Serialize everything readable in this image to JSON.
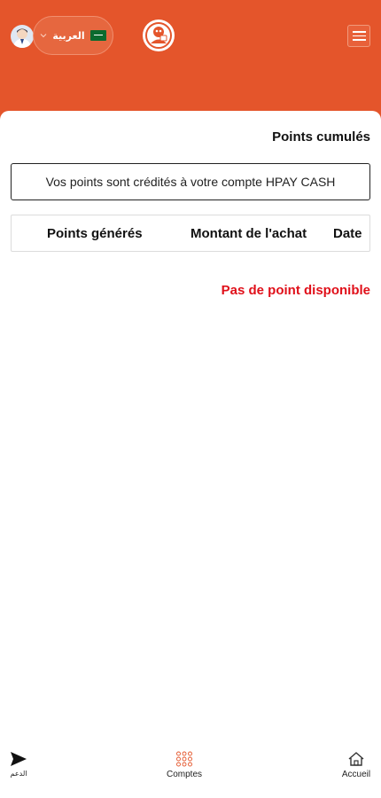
{
  "header": {
    "language_label": "العربية",
    "avatar_icon": "user-avatar-icon",
    "flag_icon": "saudi-flag-icon",
    "logo_icon": "brand-logo-icon",
    "menu_icon": "hamburger-menu-icon",
    "background_color": "#e4552b"
  },
  "main": {
    "title": "Points cumulés",
    "info_text": "Vos points sont crédités à votre compte HPAY CASH",
    "columns": [
      "Points générés",
      "Montant de l'achat",
      "Date"
    ],
    "rows": [],
    "empty_message": "Pas de point disponible",
    "empty_message_color": "#e0101a"
  },
  "bottom_nav": {
    "items": [
      {
        "label": "الدعم",
        "icon": "send-icon"
      },
      {
        "label": "Comptes",
        "icon": "grid-dots-icon"
      },
      {
        "label": "Accueil",
        "icon": "home-icon"
      }
    ],
    "accent_color": "#e4552b"
  }
}
